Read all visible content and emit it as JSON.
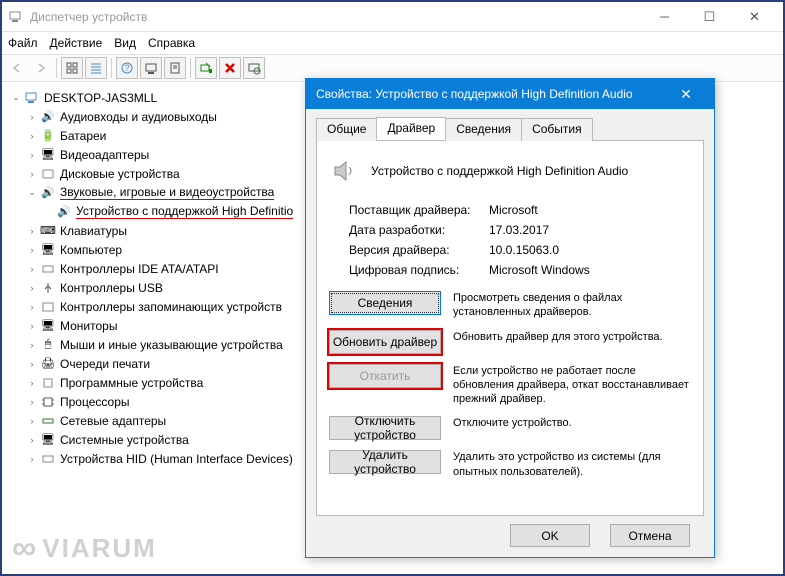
{
  "window": {
    "title": "Диспетчер устройств"
  },
  "menu": {
    "file": "Файл",
    "action": "Действие",
    "view": "Вид",
    "help": "Справка"
  },
  "tree": {
    "root": "DESKTOP-JAS3MLL",
    "items": [
      "Аудиовходы и аудиовыходы",
      "Батареи",
      "Видеоадаптеры",
      "Дисковые устройства",
      "Звуковые, игровые и видеоустройства",
      "Клавиатуры",
      "Компьютер",
      "Контроллеры IDE ATA/ATAPI",
      "Контроллеры USB",
      "Контроллеры запоминающих устройств",
      "Мониторы",
      "Мыши и иные указывающие устройства",
      "Очереди печати",
      "Программные устройства",
      "Процессоры",
      "Сетевые адаптеры",
      "Системные устройства",
      "Устройства HID (Human Interface Devices)"
    ],
    "hdaudio": "Устройство с поддержкой High Definitio"
  },
  "dialog": {
    "title": "Свойства: Устройство с поддержкой High Definition Audio",
    "tabs": [
      "Общие",
      "Драйвер",
      "Сведения",
      "События"
    ],
    "device_name": "Устройство с поддержкой High Definition Audio",
    "info": {
      "provider_label": "Поставщик драйвера:",
      "provider": "Microsoft",
      "date_label": "Дата разработки:",
      "date": "17.03.2017",
      "version_label": "Версия драйвера:",
      "version": "10.0.15063.0",
      "signer_label": "Цифровая подпись:",
      "signer": "Microsoft Windows"
    },
    "buttons": {
      "details": "Сведения",
      "update": "Обновить драйвер",
      "rollback": "Откатить",
      "disable": "Отключить устройство",
      "uninstall": "Удалить устройство"
    },
    "desc": {
      "details": "Просмотреть сведения о файлах установленных драйверов.",
      "update": "Обновить драйвер для этого устройства.",
      "rollback": "Если устройство не работает после обновления драйвера, откат восстанавливает прежний драйвер.",
      "disable": "Отключите устройство.",
      "uninstall": "Удалить это устройство из системы (для опытных пользователей)."
    },
    "ok": "OK",
    "cancel": "Отмена"
  },
  "watermark": "VIARUM"
}
